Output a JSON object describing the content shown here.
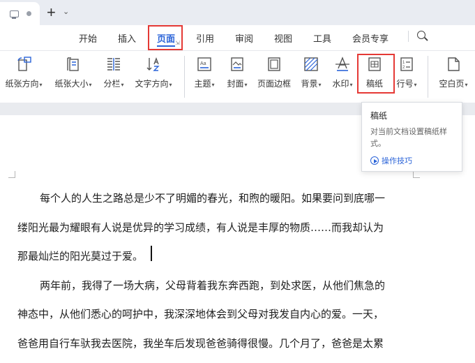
{
  "menu": {
    "tabs": [
      "开始",
      "插入",
      "页面",
      "引用",
      "审阅",
      "视图",
      "工具",
      "会员专享"
    ],
    "active_tab": "页面"
  },
  "toolbar": {
    "buttons": [
      {
        "label": "纸张方向",
        "icon": "paper-orientation-icon"
      },
      {
        "label": "纸张大小",
        "icon": "paper-size-icon"
      },
      {
        "label": "分栏",
        "icon": "columns-icon"
      },
      {
        "label": "文字方向",
        "icon": "text-direction-icon"
      },
      {
        "label": "主题",
        "icon": "theme-icon"
      },
      {
        "label": "封面",
        "icon": "cover-icon"
      },
      {
        "label": "页面边框",
        "icon": "page-border-icon"
      },
      {
        "label": "背景",
        "icon": "background-icon"
      },
      {
        "label": "水印",
        "icon": "watermark-icon"
      },
      {
        "label": "稿纸",
        "icon": "manuscript-paper-icon"
      },
      {
        "label": "行号",
        "icon": "line-number-icon"
      },
      {
        "label": "空白页",
        "icon": "blank-page-icon"
      }
    ]
  },
  "tooltip": {
    "title": "稿纸",
    "description": "对当前文档设置稿纸样式。",
    "link": "操作技巧"
  },
  "document": {
    "lines": [
      "每个人的人生之路总是少不了明媚的春光，和煦的暖阳。如果要问到底哪一",
      "缕阳光最为耀眼有人说是优异的学习成绩，有人说是丰厚的物质……而我却认为",
      "那最灿烂的阳光莫过于爱。",
      "两年前，我得了一场大病，父母背着我东奔西跑，到处求医，从他们焦急的",
      "神态中，从他们悉心的呵护中，我深深地体会到父母对我发自内心的爱。一天，",
      "爸爸用自行车驮我去医院，我坐车后发现爸爸骑得很慢。几个月了，爸爸是太累"
    ]
  },
  "colors": {
    "accent": "#2a63d8",
    "highlight_box": "#e53935"
  }
}
